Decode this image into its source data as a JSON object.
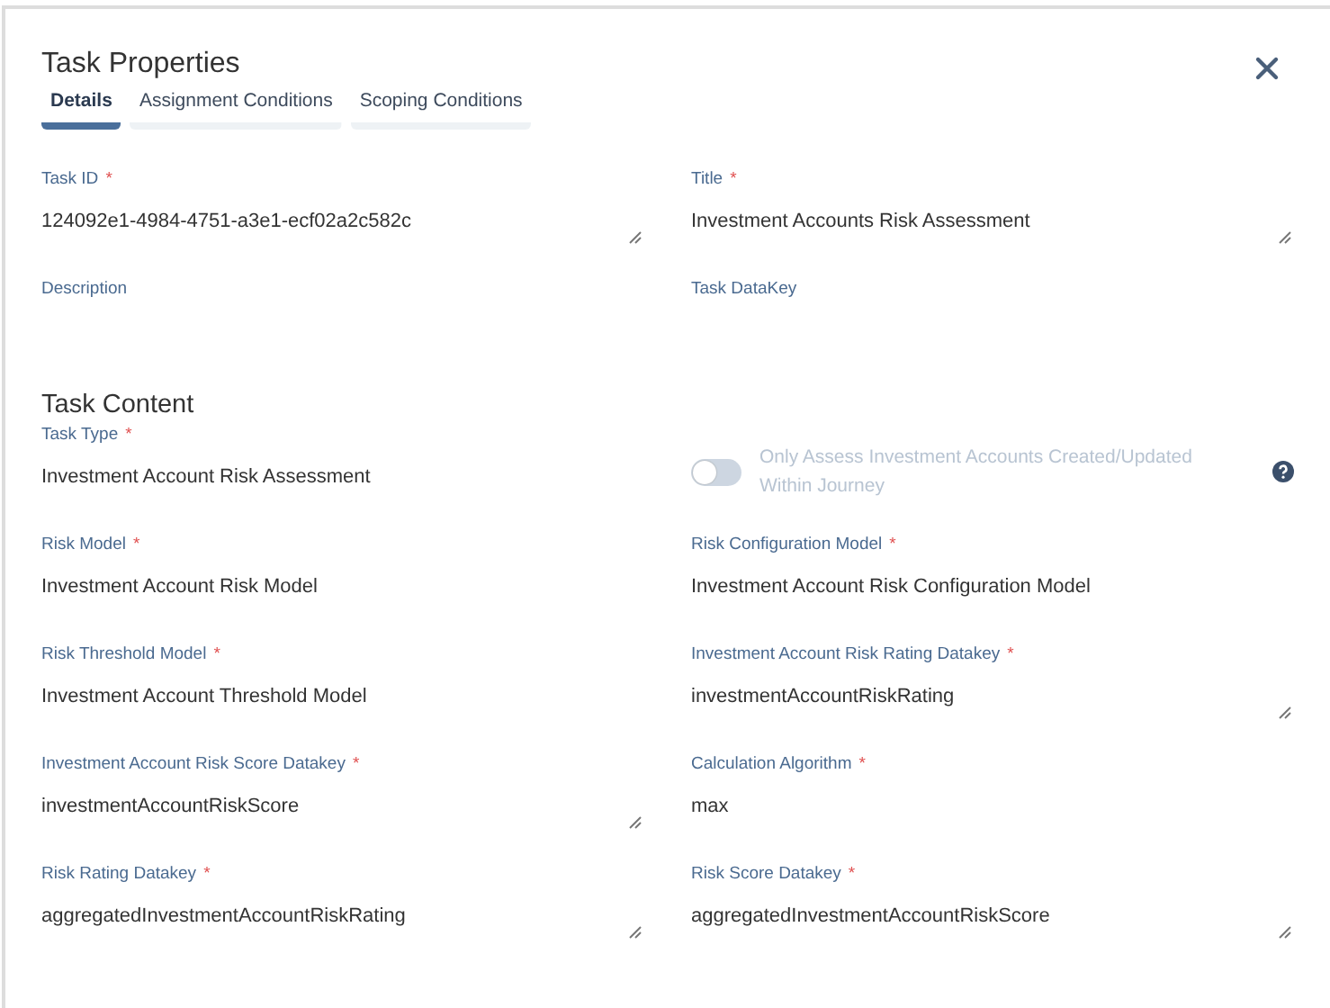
{
  "dialog": {
    "title": "Task Properties"
  },
  "tabs": [
    {
      "label": "Details",
      "selected": true
    },
    {
      "label": "Assignment Conditions",
      "selected": false
    },
    {
      "label": "Scoping Conditions",
      "selected": false
    }
  ],
  "top_fields": [
    {
      "kind": "textarea",
      "label": "Task ID",
      "required_mark": "*",
      "value": "124092e1-4984-4751-a3e1-ecf02a2c582c"
    },
    {
      "kind": "textarea",
      "label": "Title",
      "required_mark": "*",
      "value": "Investment Accounts Risk Assessment"
    },
    {
      "kind": "text",
      "label": "Description"
    },
    {
      "kind": "text",
      "label": "Task DataKey"
    }
  ],
  "section": {
    "title": "Task Content"
  },
  "content_fields": [
    {
      "kind": "text",
      "label": "Task Type",
      "required_mark": "*",
      "value": "Investment Account Risk Assessment"
    },
    {
      "kind": "toggle",
      "label": "Only Assess Investment Accounts Created/Updated Within Journey",
      "on": false,
      "disabled": true
    },
    {
      "kind": "text",
      "label": "Risk Model",
      "required_mark": "*",
      "value": "Investment Account Risk Model"
    },
    {
      "kind": "text",
      "label": "Risk Configuration Model",
      "required_mark": "*",
      "value": "Investment Account Risk Configuration Model"
    },
    {
      "kind": "text",
      "label": "Risk Threshold Model",
      "required_mark": "*",
      "value": "Investment Account Threshold Model"
    },
    {
      "kind": "textarea",
      "label": "Investment Account Risk Rating Datakey",
      "required_mark": "*",
      "value": "investmentAccountRiskRating"
    },
    {
      "kind": "textarea",
      "label": "Investment Account Risk Score Datakey",
      "required_mark": "*",
      "value": "investmentAccountRiskScore"
    },
    {
      "kind": "text",
      "label": "Calculation Algorithm",
      "required_mark": "*",
      "value": "max"
    },
    {
      "kind": "textarea",
      "label": "Risk Rating Datakey",
      "required_mark": "*",
      "value": "aggregatedInvestmentAccountRiskRating"
    },
    {
      "kind": "textarea",
      "label": "Risk Score Datakey",
      "required_mark": "*",
      "value": "aggregatedInvestmentAccountRiskScore"
    }
  ]
}
